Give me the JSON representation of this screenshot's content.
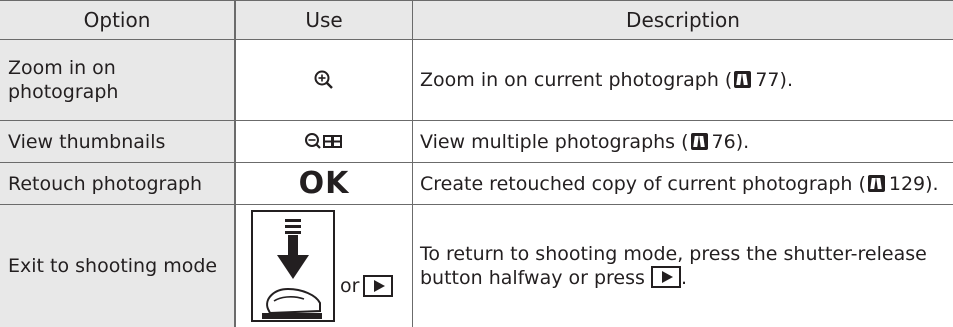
{
  "table": {
    "headers": {
      "option": "Option",
      "use": "Use",
      "description": "Description"
    },
    "rows": [
      {
        "option": "Zoom in on photograph",
        "use_icon": "zoom-in-magnifier-icon",
        "description_pre": "Zoom in on current photograph (",
        "page_ref": "77",
        "description_post": ")."
      },
      {
        "option": "View thumbnails",
        "use_icon": "thumbnail-view-icon",
        "description_pre": "View multiple photographs (",
        "page_ref": "76",
        "description_post": ")."
      },
      {
        "option": "Retouch photograph",
        "use_label": "OK",
        "description_pre": "Create retouched copy of current photograph (",
        "page_ref": "129",
        "description_post": ")."
      },
      {
        "option": "Exit to shooting mode",
        "use_icon": "shutter-release-button-icon",
        "use_or": "or",
        "use_icon_2": "playback-button-icon",
        "description_pre": "To return to shooting mode, press the shutter-release button halfway or press ",
        "description_post": "."
      }
    ]
  },
  "colors": {
    "header_bg": "#e8e8e8",
    "border": "#6b6b6b",
    "text": "#231f20"
  }
}
